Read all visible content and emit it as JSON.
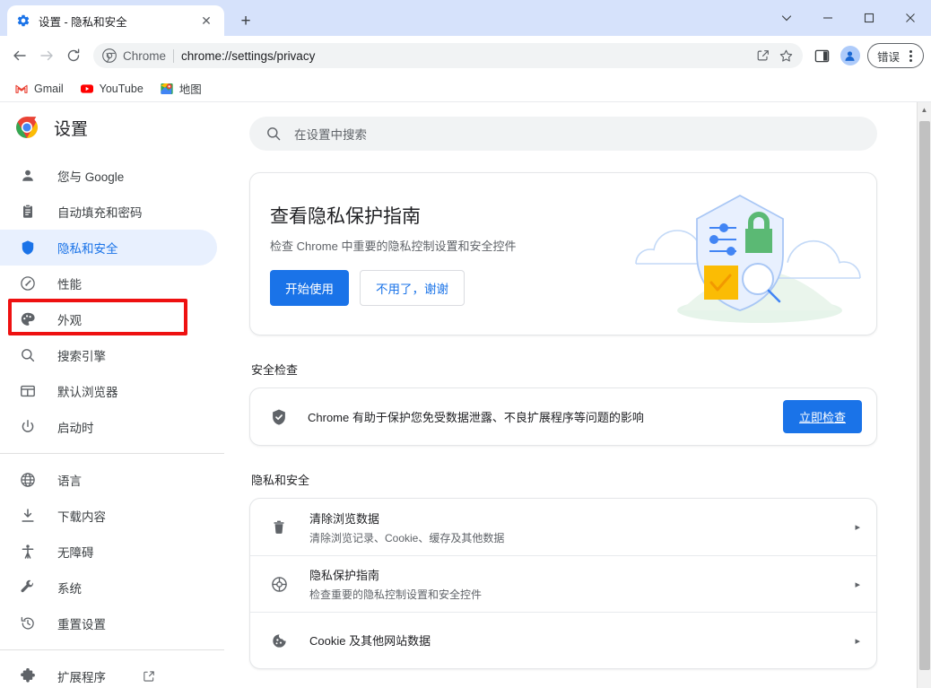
{
  "window": {
    "controls": {
      "chevron": "⌄",
      "minimize": "—",
      "maximize": "□",
      "close": "✕"
    }
  },
  "tab": {
    "title": "设置 - 隐私和安全",
    "favicon_name": "settings-gear-icon",
    "close_label": "✕",
    "newtab_label": "+"
  },
  "toolbar": {
    "back_label": "←",
    "forward_label": "→",
    "reload_label": "⟳",
    "omnibox": {
      "chip_label": "Chrome",
      "url": "chrome://settings/privacy",
      "share_label": "share-icon",
      "bookmark_label": "☆"
    },
    "side_panel_label": "side-panel-icon",
    "profile_label": "profile-avatar",
    "error_badge": "错误",
    "menu_label": "more-menu"
  },
  "bookmarks": [
    {
      "label": "Gmail",
      "icon": "gmail-icon"
    },
    {
      "label": "YouTube",
      "icon": "youtube-icon"
    },
    {
      "label": "地图",
      "icon": "maps-icon"
    }
  ],
  "sidebar": {
    "brand_title": "设置",
    "brand_logo": "chrome-logo",
    "items": [
      {
        "label": "您与 Google",
        "icon": "person-icon",
        "selected": false
      },
      {
        "label": "自动填充和密码",
        "icon": "clipboard-icon",
        "selected": false,
        "highlighted": true
      },
      {
        "label": "隐私和安全",
        "icon": "shield-icon",
        "selected": true
      },
      {
        "label": "性能",
        "icon": "speedometer-icon",
        "selected": false
      },
      {
        "label": "外观",
        "icon": "palette-icon",
        "selected": false
      },
      {
        "label": "搜索引擎",
        "icon": "search-icon",
        "selected": false
      },
      {
        "label": "默认浏览器",
        "icon": "browser-window-icon",
        "selected": false
      },
      {
        "label": "启动时",
        "icon": "power-icon",
        "selected": false
      }
    ],
    "items2": [
      {
        "label": "语言",
        "icon": "globe-icon"
      },
      {
        "label": "下载内容",
        "icon": "download-icon"
      },
      {
        "label": "无障碍",
        "icon": "accessibility-icon"
      },
      {
        "label": "系统",
        "icon": "wrench-icon"
      },
      {
        "label": "重置设置",
        "icon": "restore-icon"
      }
    ],
    "items3": [
      {
        "label": "扩展程序",
        "icon": "puzzle-icon",
        "external": true
      }
    ],
    "highlight_color": "#ee1111",
    "selected_bg": "#e8f0fe",
    "selected_fg": "#1a73e8"
  },
  "search": {
    "placeholder": "在设置中搜索",
    "icon": "search-icon"
  },
  "promo": {
    "title": "查看隐私保护指南",
    "subtitle": "检查 Chrome 中重要的隐私控制设置和安全控件",
    "primary_button": "开始使用",
    "secondary_button": "不用了，谢谢",
    "illustration": "privacy-shield-illustration"
  },
  "safety_check": {
    "heading": "安全检查",
    "description": "Chrome 有助于保护您免受数据泄露、不良扩展程序等问题的影响",
    "button": "立即检查",
    "icon": "shield-check-icon"
  },
  "privacy_section": {
    "heading": "隐私和安全",
    "rows": [
      {
        "title": "清除浏览数据",
        "subtitle": "清除浏览记录、Cookie、缓存及其他数据",
        "icon": "trash-icon",
        "arrow": "▸"
      },
      {
        "title": "隐私保护指南",
        "subtitle": "检查重要的隐私控制设置和安全控件",
        "icon": "privacy-guide-icon",
        "arrow": "▸"
      },
      {
        "title": "Cookie 及其他网站数据",
        "subtitle": "",
        "icon": "cookie-icon",
        "arrow": "▸"
      }
    ]
  },
  "scrollbar": {
    "up_arrow": "▲"
  },
  "colors": {
    "accent": "#1a73e8",
    "tabstrip": "#d6e2fb",
    "selected_nav": "#e8f0fe",
    "highlight": "#ee1111"
  }
}
